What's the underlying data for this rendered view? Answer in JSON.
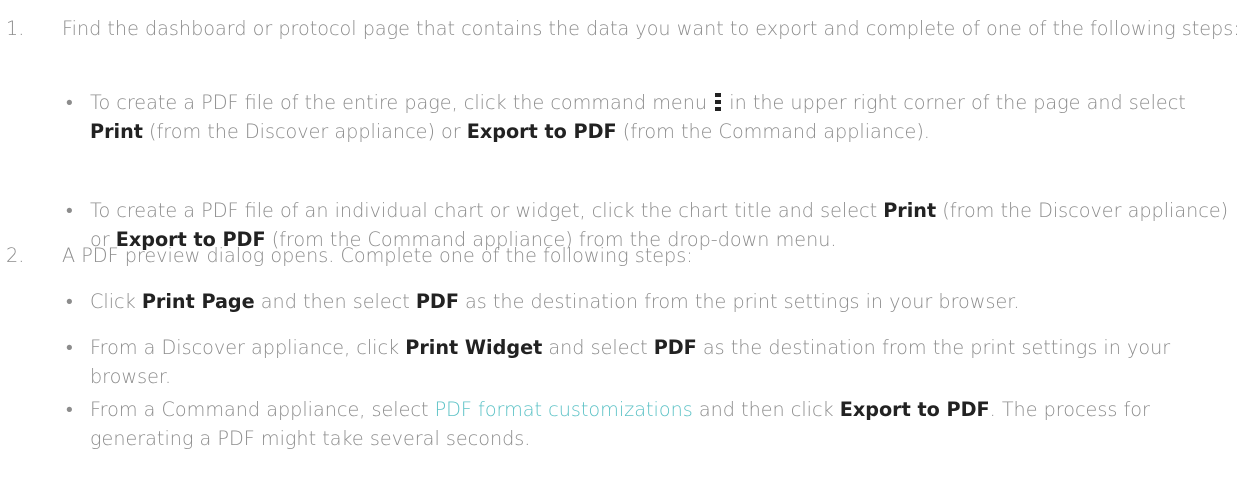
{
  "steps": [
    {
      "number": "1.",
      "text": "Find the dashboard or protocol page that contains the data you want to export and complete of one of the following steps:",
      "bullets": [
        {
          "t1": "To create a PDF file of the entire page, click the command menu ",
          "icon": "command-menu-icon",
          "t2": " in the upper right corner of the page and select ",
          "b1": "Print",
          "t3": " (from the Discover appliance) or ",
          "b2": "Export to PDF",
          "t4": " (from the Command appliance)."
        },
        {
          "t1": "To create a PDF file of an individual chart or widget, click the chart title and select ",
          "b1": "Print",
          "t2": " (from the Discover appliance) or ",
          "b2": "Export to PDF",
          "t3": " (from the Command appliance) from the drop-down menu."
        }
      ]
    },
    {
      "number": "2.",
      "text": "A PDF preview dialog opens. Complete one of the following steps:",
      "bullets": [
        {
          "t1": "Click ",
          "b1": "Print Page",
          "t2": " and then select ",
          "b2": "PDF",
          "t3": " as the destination from the print settings in your browser."
        },
        {
          "t1": "From a Discover appliance, click ",
          "b1": "Print Widget",
          "t2": " and select ",
          "b2": "PDF",
          "t3": " as the destination from the print settings in your browser."
        },
        {
          "t1": "From a Command appliance, select ",
          "link": "PDF format customizations",
          "t2": " and then click ",
          "b1": "Export to PDF",
          "t3": ". The process for generating a PDF might take several seconds."
        }
      ]
    }
  ],
  "bullet_glyph": "•",
  "colors": {
    "text": "#8c8c8c",
    "bold": "#222222",
    "link": "#5cc2c6"
  }
}
